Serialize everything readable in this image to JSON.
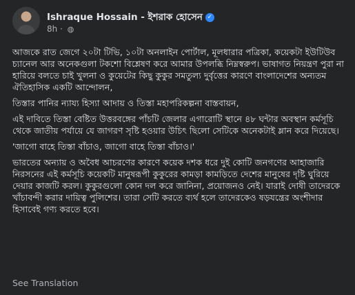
{
  "post": {
    "author": "Ishraque Hossain - ইশরাক হোসেন",
    "time": "8h",
    "privacy_icon": "globe-icon",
    "paragraphs": [
      "আজকে রাত জেগে ২০টা টিভি, ১০টা অনলাইন পোর্টাল, মূলধারার পত্রিকা, কয়েকটা ইউটিউব চ্যানেল আর অনেকগুলা টকশো বিশ্লেষণ করে আমার উপলব্ধি নিম্নস্বরুপ। ভাষাগত নিয়ন্ত্রণ পুরা না হারিয়ে বলতে চাই খুলনা ও কুয়েটের কিছু কুকুর সমতুল্য দুর্বৃত্তের কারণে বাংলাদেশের অন্যতম ঐতিহাসিক একটি আন্দোলন,",
      "তিস্তার পানির ন্যায্য হিস্যা আদায় ও তিস্তা মহাপরিকল্পনা বাস্তবায়ন,",
      "এই দাবিতে তিস্তা বেষ্টিত উত্তরবঙ্গের পাঁচটি জেলার এগারোটি স্থানে ৪৮ ঘন্টার অবস্থান কর্মসূচি থেকে জাতীয় পর্যায়ে যে জাগরণ সৃষ্টি হওয়ার উচিৎ ছিলো সেটিকে অনেকটাই ম্লান করে দিয়েছে।",
      "'জাগো বাহে তিস্তা বাঁচাও, জাগো বাহে তিস্তা বাঁচাও।'",
      "ভারতের অন্যায় ও অবৈধ আচরণের কারণে কয়েক দশক ধরে দুই কোটি জনগণের আহাজারি নিরসনের এই কর্মসূচি কয়েকটি মানুষরূপী কুকুরের কামড়া কামড়িতে দেশের মানুষের দৃষ্টি ঘুরিয়ে দেয়ার কাজটি করল। কুকুরগুলো কোন দল করে জানিনা, প্রয়োজনও নেই। যারাই দোষী তাদেরকে খাঁচাবন্দী করার দায়িত্ব পুলিশের। তারা সেটি করতে ব্যর্থ হলে তাদেরকেও ষড়যন্ত্রের অংশীদার হিসাবেই গণ্য করতে হবে।"
    ],
    "see_translation": "See Translation"
  },
  "colors": {
    "card_bg": "#242526",
    "text_primary": "#e4e6eb",
    "text_secondary": "#b0b3b8",
    "verified": "#2d88ff"
  }
}
